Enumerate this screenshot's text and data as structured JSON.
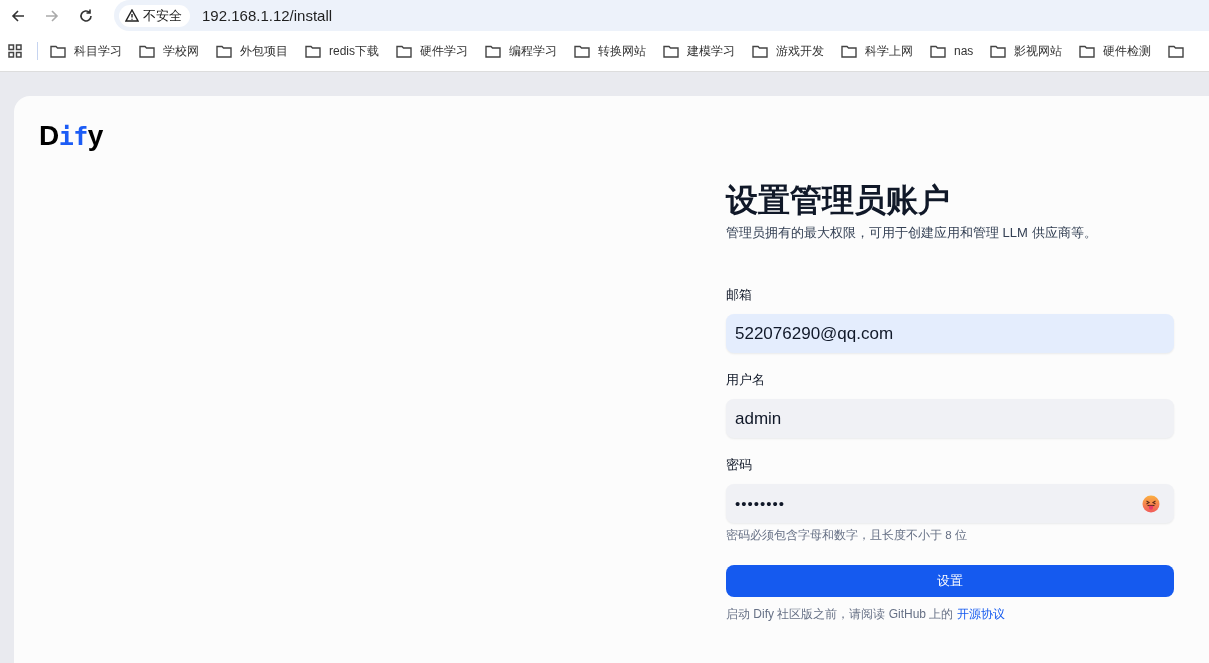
{
  "browser": {
    "security_label": "不安全",
    "url": "192.168.1.12/install",
    "bookmarks": [
      {
        "label": "科目学习"
      },
      {
        "label": "学校网"
      },
      {
        "label": "外包项目"
      },
      {
        "label": "redis下载"
      },
      {
        "label": "硬件学习"
      },
      {
        "label": "编程学习"
      },
      {
        "label": "转换网站"
      },
      {
        "label": "建模学习"
      },
      {
        "label": "游戏开发"
      },
      {
        "label": "科学上网"
      },
      {
        "label": "nas"
      },
      {
        "label": "影视网站"
      },
      {
        "label": "硬件检测"
      }
    ]
  },
  "logo": {
    "parts": [
      {
        "text": "D",
        "accent": false
      },
      {
        "text": "if",
        "accent": true
      },
      {
        "text": "y",
        "accent": false
      }
    ]
  },
  "form": {
    "title": "设置管理员账户",
    "subtitle": "管理员拥有的最大权限，可用于创建应用和管理 LLM 供应商等。",
    "fields": [
      {
        "label": "邮箱",
        "value": "522076290@qq.com",
        "autofilled": true,
        "kind": "text"
      },
      {
        "label": "用户名",
        "value": "admin",
        "autofilled": false,
        "kind": "text"
      },
      {
        "label": "密码",
        "value": "••••••••",
        "autofilled": false,
        "kind": "password",
        "hint": "密码必须包含字母和数字，且长度不小于 8 位"
      }
    ],
    "submit": "设置",
    "footer": {
      "text": "启动 Dify 社区版之前，请阅读 GitHub 上的",
      "link": "开源协议"
    }
  }
}
